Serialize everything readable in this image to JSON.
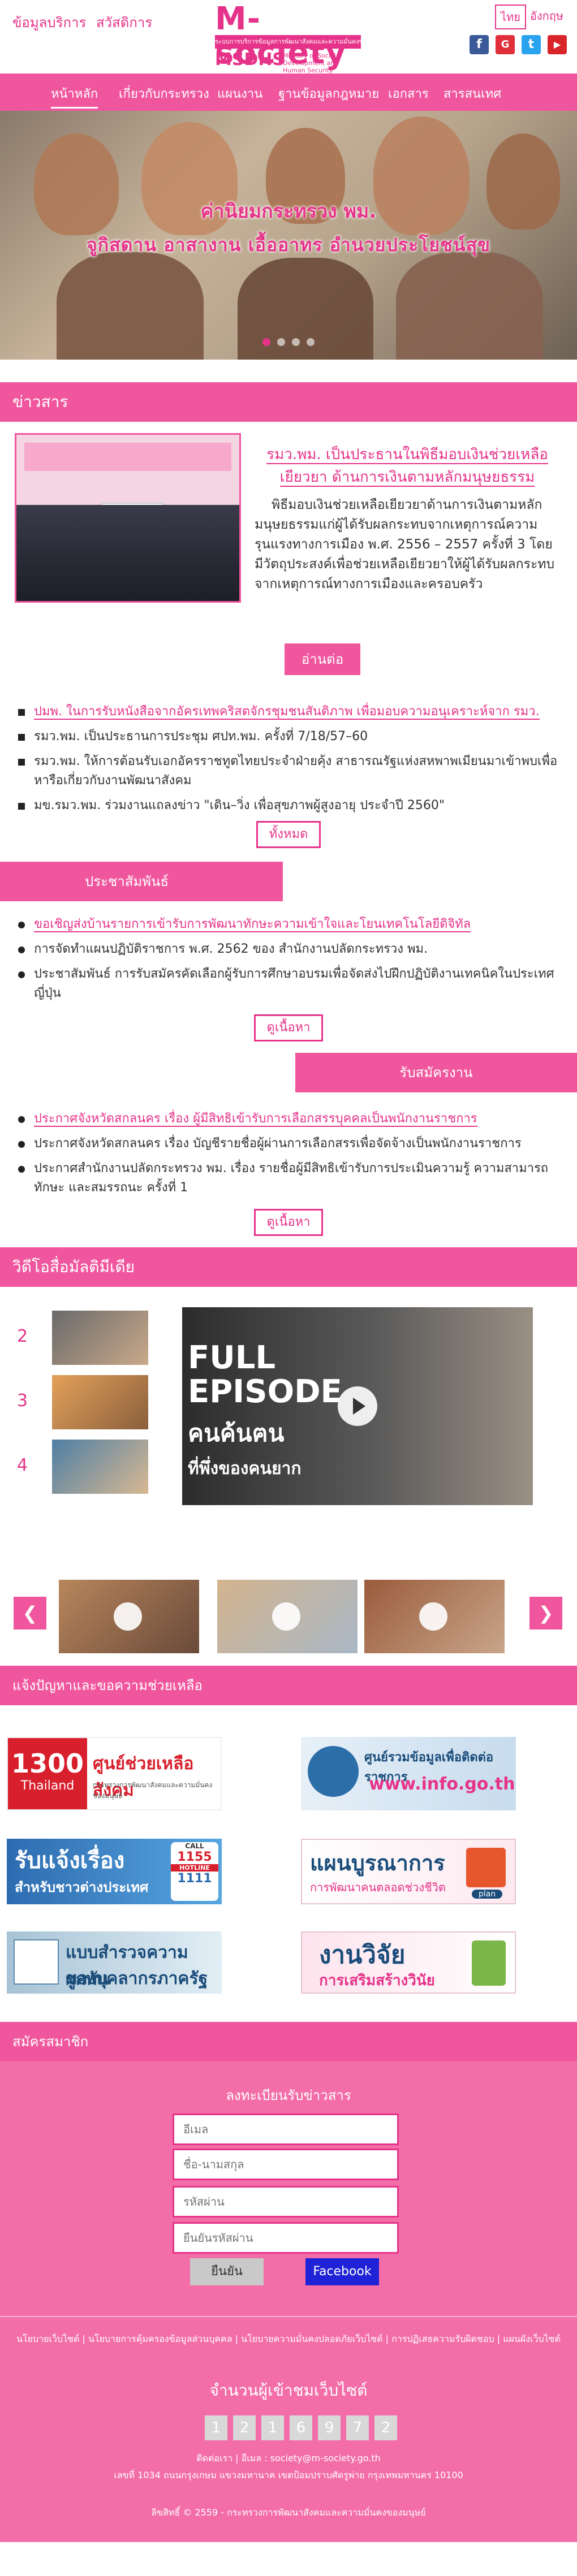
{
  "header": {
    "link_info": "ข้อมูลบริการ",
    "link_welfare": "สวัสดิการ",
    "logo_text": "M-society",
    "logo_bar": "ระบบการบริการข้อมูลการพัฒนาสังคมและความมั่นคงของมนุษย์",
    "logo_short": "MSDHS",
    "logo_eng": "Ministry of Social Development and Human Security",
    "lang_th": "ไทย",
    "lang_en": "อังกฤษ"
  },
  "nav": {
    "items": [
      "หน้าหลัก",
      "เกี่ยวกับกระทรวง",
      "แผนงาน",
      "ฐานข้อมูลกฎหมาย",
      "เอกสาร",
      "สารสนเทศ"
    ]
  },
  "hero": {
    "line1": "ค่านิยมกระทรวง พม.",
    "line2": "จูกิสดาน   อาสางาน   เอื้ออาทร   อำนวยประโยชน์สุข"
  },
  "news": {
    "section": "ข่าวสาร",
    "main_title": "รมว.พม. เป็นประธานในพิธีมอบเงินช่วยเหลือเยียวยา ด้านการเงินตามหลักมนุษยธรรม",
    "main_body": "พิธีมอบเงินช่วยเหลือเยียวยาด้านการเงินตามหลักมนุษยธรรมแก่ผู้ได้รับผลกระทบจากเหตุการณ์ความรุนแรงทางการเมือง พ.ศ. 2556 – 2557 ครั้งที่ 3 โดยมีวัตถุประสงค์เพื่อช่วยเหลือเยียวยาให้ผู้ได้รับผลกระทบจากเหตุการณ์ทางการเมืองและครอบครัว",
    "read_more": "อ่านต่อ",
    "items": [
      "ปมพ. ในการรับหนังสือจากอัครเทพคริสตจักรชุมชนสันติภาพ เพื่อมอบความอนุเคราะห์จาก รมว.",
      "รมว.พม. เป็นประธานการประชุม ศปท.พม. ครั้งที่ 7/18/57–60",
      "รมว.พม. ให้การต้อนรับเอกอัครราชทูตไทยประจำฝ่ายคุ้ง สาธารณรัฐแห่งสหพาพเมียนมาเข้าพบเพื่อหารือเกี่ยวกับงานพัฒนาสังคม",
      "มข.รมว.พม. ร่วมงานแถลงข่าว \"เดิน–วิ่ง เพื่อสุขภาพผู้สูงอายุ ประจำปี 2560\""
    ],
    "all": "ทั้งหมด"
  },
  "pr": {
    "section": "ประชาสัมพันธ์",
    "items": [
      "ขอเชิญส่งบ้านรายการเข้ารับการพัฒนาทักษะความเข้าใจและโยนเทคโนโลยีดิจิทัล",
      "การจัดทำแผนปฏิบัติราชการ พ.ศ. 2562 ของ สำนักงานปลัดกระทรวง พม.",
      "ประชาสัมพันธ์ การรับสมัครคัดเลือกผู้รับการศึกษาอบรมเพื่อจัดส่งไปฝึกปฏิบัติงานเทคนิคในประเทศญี่ปุ่น"
    ],
    "more": "ดูเนื้อหา"
  },
  "jobs": {
    "section": "รับสมัครงาน",
    "items": [
      "ประกาศจังหวัดสกลนคร เรื่อง ผู้มีสิทธิเข้ารับการเลือกสรรบุคคลเป็นพนักงานราชการ",
      "ประกาศจังหวัดสกลนคร เรื่อง บัญชีรายชื่อผู้ผ่านการเลือกสรรเพื่อจัดจ้างเป็นพนักงานราชการ",
      "ประกาศสำนักงานปลัดกระทรวง พม. เรื่อง รายชื่อผู้มีสิทธิเข้ารับการประเมินความรู้ ความสามารถ ทักษะ และสมรรถนะ ครั้งที่ 1"
    ],
    "more": "ดูเนื้อหา"
  },
  "video": {
    "section": "วิดีโอสื่อมัลติมีเดีย",
    "nums": [
      "2",
      "3",
      "4"
    ],
    "player_full": "FULL",
    "player_episode": "EPISODE",
    "player_sub": "คนค้นฅน",
    "player_sub2": "ที่พึ่งของคนยาก",
    "prev": "❮",
    "next": "❯"
  },
  "report": {
    "section": "แจ้งปัญหาและขอความช่วยเหลือ",
    "b1_num": "1300",
    "b1_country": "Thailand",
    "b1_title": "ศูนย์ช่วยเหลือสังคม",
    "b1_sub": "กระทรวงการพัฒนาสังคมและความมั่นคงของมนุษย์",
    "b2_title": "ศูนย์รวมข้อมูลเพื่อติดต่อราชการ",
    "b2_url": "www.info.go.th",
    "b3_title": "รับแจ้งเรื่อง",
    "b3_sub": "สำหรับชาวต่างประเทศ",
    "b3_call": "CALL",
    "b3_hot1": "1155",
    "b3_hot2": "HOTLINE",
    "b3_hot3": "1111",
    "b4_title": "แผนบูรณาการ",
    "b4_sub": "การพัฒนาคนตลอดช่วงชีวิต",
    "b4_plan": "plan",
    "b5_title": "แบบสำรวจความผูกพัน",
    "b5_sub": "ของบุคลากรภาครัฐ",
    "b6_title": "งานวิจัย",
    "b6_sub": "การเสริมสร้างวินัย"
  },
  "member": {
    "section": "สมัครสมาชิก",
    "title": "ลงทะเบียนรับข่าวสาร",
    "email": "อีเมล",
    "name": "ชื่อ-นามสกุล",
    "password": "รหัสผ่าน",
    "confirm": "ยืนยันรหัสผ่าน",
    "submit": "ยืนยัน",
    "facebook": "Facebook"
  },
  "footer": {
    "links": "นโยบายเว็บไซต์ | นโยบายการคุ้มครองข้อมูลส่วนบุคคล | นโยบายความมั่นคงปลอดภัยเว็บไซต์ | การปฏิเสธความรับผิดชอบ | แผนผังเว็บไซต์",
    "visitors_label": "จำนวนผู้เข้าชมเว็บไซต์",
    "digits": [
      "1",
      "2",
      "1",
      "6",
      "9",
      "7",
      "2"
    ],
    "contact": "ติดต่อเรา | อีเมล : society@m-society.go.th",
    "address": "เลขที่ 1034 ถนนกรุงเกษม แขวงมหานาค เขตป้อมปราบศัตรูพ่าย กรุงเทพมหานคร 10100",
    "copyright": "ลิขสิทธิ์ © 2559 - กระทรวงการพัฒนาสังคมและความมั่นคงของมนุษย์"
  }
}
